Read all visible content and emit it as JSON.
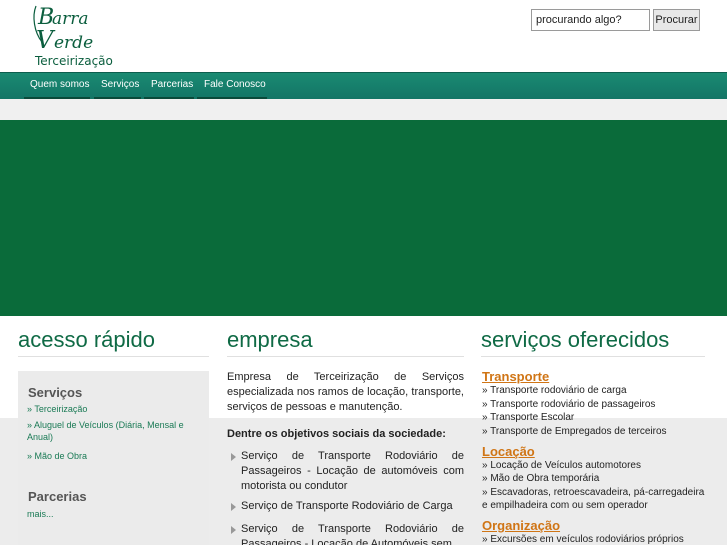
{
  "header": {
    "logo_tagline": "Terceirização",
    "search": {
      "placeholder": "procurando algo?",
      "button_label": "Procurar"
    }
  },
  "nav": {
    "items": [
      {
        "label": "Quem somos"
      },
      {
        "label": "Serviços"
      },
      {
        "label": "Parcerias"
      },
      {
        "label": "Fale Conosco"
      }
    ]
  },
  "colors": {
    "brand_green": "#0f6a45",
    "nav_teal": "#137566",
    "banner_green": "#0a6b3a",
    "accent_orange": "#d07515"
  },
  "acesso": {
    "title": "acesso rápido",
    "servicos_heading": "Serviços",
    "servicos_links": [
      "» Terceirização",
      "» Aluguel de Veículos (Diária, Mensal e Anual)",
      "» Mão de Obra"
    ],
    "parcerias_heading": "Parcerias",
    "parcerias_more": "mais..."
  },
  "empresa": {
    "title": "empresa",
    "intro": "Empresa de Terceirização de Serviços especializada nos ramos de locação, transporte, serviços de pessoas e manutenção.",
    "objectives_heading": "Dentre os objetivos sociais da sociedade:",
    "objectives": [
      "Serviço de Transporte Rodoviário de Passageiros - Locação de automóveis com motorista ou condutor",
      "Serviço de Transporte Rodoviário de Carga",
      "Serviço de Transporte Rodoviário de Passageiros - Locação de Automóveis sem"
    ]
  },
  "servicos": {
    "title": "serviços oferecidos",
    "categories": [
      {
        "name": "Transporte",
        "items": [
          "» Transporte rodoviário de carga",
          "» Transporte rodoviário de passageiros",
          "» Transporte Escolar",
          "» Transporte de Empregados de terceiros"
        ]
      },
      {
        "name": "Locação",
        "items": [
          "» Locação de Veículos automotores",
          "» Mão de Obra temporária",
          "» Escavadoras, retroescavadeira, pá-carregadeira e empilhadeira com ou sem operador"
        ]
      },
      {
        "name": "Organização",
        "items": [
          "» Excursões em veículos rodoviários próprios"
        ]
      }
    ]
  }
}
